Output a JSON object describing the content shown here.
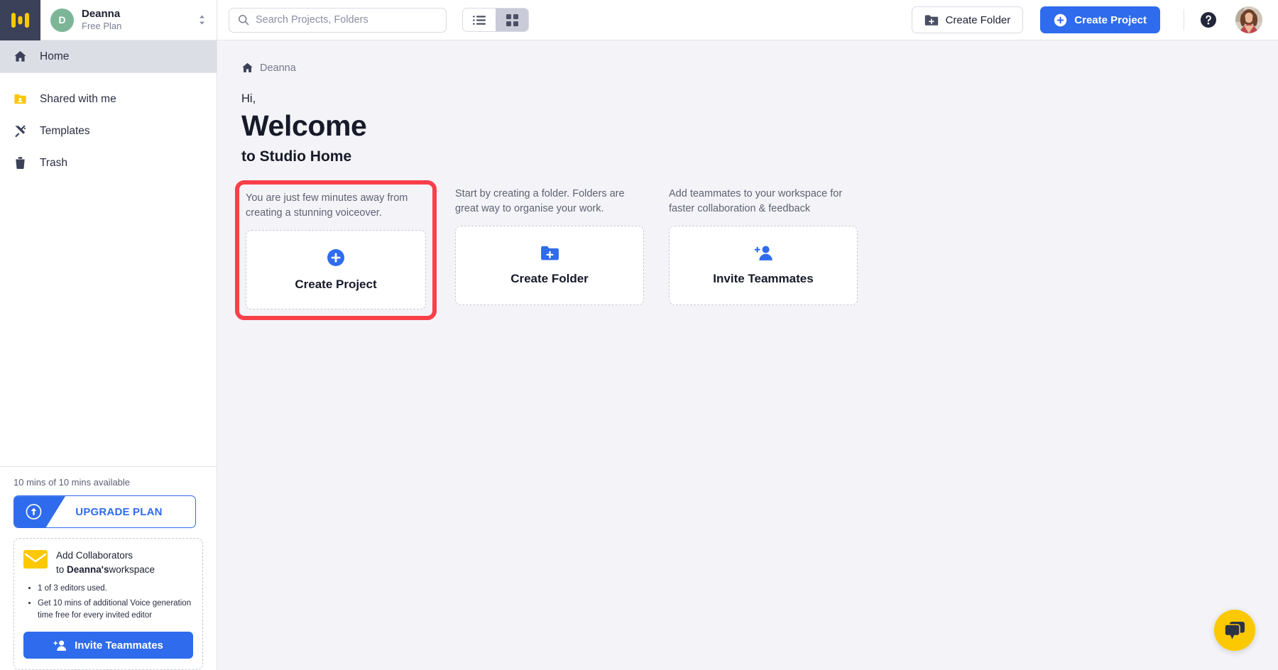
{
  "sidebar": {
    "logo_icon": "studio-logo-icon",
    "workspace": {
      "avatar_letter": "D",
      "name": "Deanna",
      "plan": "Free Plan",
      "switcher_icon": "chevron-up-down-icon"
    },
    "nav_primary": [
      {
        "label": "Home",
        "icon": "home-icon",
        "active": true
      }
    ],
    "nav_secondary": [
      {
        "label": "Shared with me",
        "icon": "shared-folder-icon"
      },
      {
        "label": "Templates",
        "icon": "templates-icon"
      },
      {
        "label": "Trash",
        "icon": "trash-icon"
      }
    ],
    "usage": {
      "mins_text": "10 mins of 10 mins available",
      "upgrade_label": "UPGRADE PLAN",
      "upgrade_icon": "upgrade-arrow-icon"
    },
    "collaborators": {
      "mail_icon": "envelope-icon",
      "title_line1": "Add Collaborators",
      "title_line2_prefix": "to ",
      "title_line2_bold": "Deanna's",
      "title_line2_suffix": "workspace",
      "bullets": [
        "1 of 3 editors used.",
        "Get 10 mins of additional Voice generation time free for every invited editor"
      ],
      "invite_label": "Invite Teammates",
      "invite_icon": "person-add-icon"
    }
  },
  "topbar": {
    "search": {
      "placeholder": "Search Projects, Folders",
      "value": "",
      "icon": "search-icon"
    },
    "view_toggle": {
      "list_icon": "list-view-icon",
      "grid_icon": "grid-view-icon",
      "active": "grid"
    },
    "create_folder_label": "Create Folder",
    "create_folder_icon": "folder-plus-icon",
    "create_project_label": "Create Project",
    "create_project_icon": "plus-circle-icon",
    "help_icon": "help-circle-icon",
    "avatar_name": "avatar"
  },
  "content": {
    "breadcrumb": {
      "home_icon": "home-icon",
      "label": "Deanna"
    },
    "greeting": "Hi,",
    "welcome": "Welcome",
    "subtitle": "to Studio Home",
    "cards": [
      {
        "description": "You are just few minutes away from creating a stunning voiceover.",
        "label": "Create Project",
        "icon": "plus-circle-icon",
        "highlighted": true
      },
      {
        "description": "Start by creating a folder. Folders are great way to organise your work.",
        "label": "Create Folder",
        "icon": "folder-plus-icon",
        "highlighted": false
      },
      {
        "description": "Add teammates to your workspace for faster collaboration & feedback",
        "label": "Invite Teammates",
        "icon": "person-add-icon",
        "highlighted": false
      }
    ]
  },
  "chat": {
    "icon": "chat-bubbles-icon"
  },
  "colors": {
    "accent_blue": "#2f6bed",
    "logo_yellow": "#fcc800",
    "highlight_red": "#f8404a",
    "sidebar_dark": "#3a4158",
    "page_bg": "#f4f4f8"
  }
}
